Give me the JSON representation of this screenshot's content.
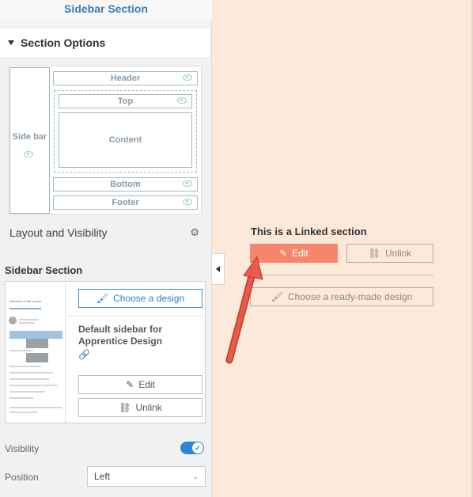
{
  "panel": {
    "title": "Sidebar Section",
    "section_options": "Section Options",
    "layout": {
      "sidebar": "Side bar",
      "header": "Header",
      "top": "Top",
      "content": "Content",
      "bottom": "Bottom",
      "footer": "Footer"
    },
    "layout_visibility": "Layout and Visibility",
    "sidebar_section": {
      "heading": "Sidebar Section",
      "choose_label": "Choose a design",
      "design_name": "Default sidebar for Apprentice Design",
      "edit_label": "Edit",
      "unlink_label": "Unlink",
      "thumbnail": {
        "title": "Structure of the course",
        "items": [
          "Lesson 1 - Intro",
          "Introduction to the Chapter",
          "Lesson 2",
          "Lesson 3 - Intro to Course",
          "Template design - Tutorial",
          "Block Editor Tutorial"
        ]
      }
    },
    "visibility_label": "Visibility",
    "position_label": "Position",
    "position_value": "Left"
  },
  "canvas": {
    "linked_title": "This is a Linked section",
    "edit_label": "Edit",
    "unlink_label": "Unlink",
    "choose_label": "Choose a ready-made design"
  },
  "colors": {
    "accent": "#2f86cf",
    "edit_button": "#f4876b",
    "canvas_bg": "#fde9d9",
    "arrow": "#e85a4a"
  }
}
